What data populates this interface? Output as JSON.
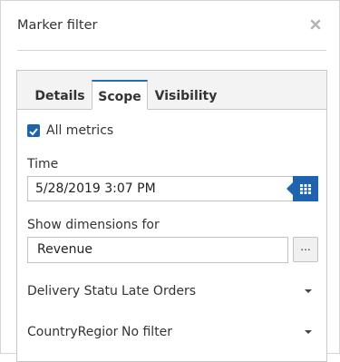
{
  "dialog": {
    "title": "Marker filter",
    "close_icon": "close-x-icon"
  },
  "tabs": [
    {
      "label": "Details",
      "active": false
    },
    {
      "label": "Scope",
      "active": true
    },
    {
      "label": "Visibility",
      "active": false
    }
  ],
  "scope": {
    "all_metrics": {
      "label": "All metrics",
      "checked": true
    },
    "time": {
      "label": "Time",
      "value": "5/28/2019 3:07 PM",
      "picker_icon": "calendar-grid-icon"
    },
    "show_dimensions": {
      "label": "Show dimensions for",
      "value": "Revenue",
      "browse_label": "..."
    },
    "dimensions": [
      {
        "name": "Delivery Status",
        "value": "Late Orders"
      },
      {
        "name": "CountryRegion",
        "value": "No filter"
      }
    ]
  },
  "colors": {
    "accent": "#1e63b0",
    "border": "#c8c8c8",
    "tab_strip": "#f3f3f3"
  }
}
